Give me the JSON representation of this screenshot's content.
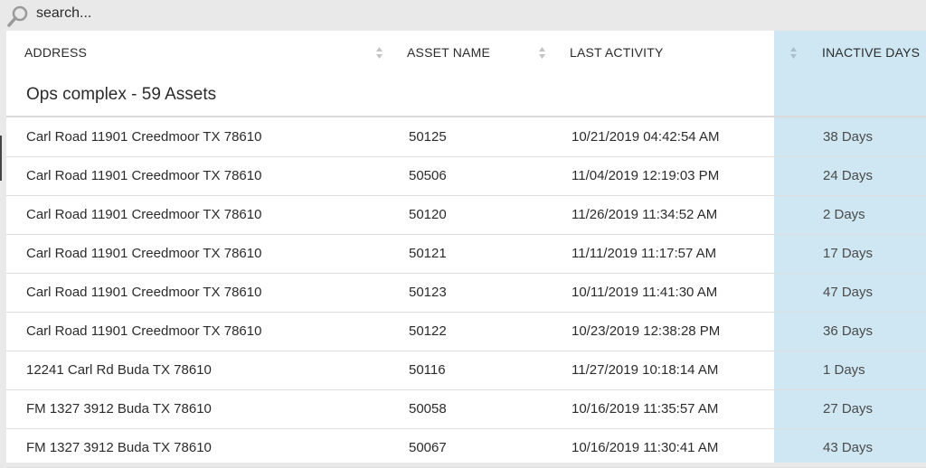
{
  "search": {
    "placeholder": "search..."
  },
  "columns": [
    {
      "label": "ADDRESS",
      "sortable": true
    },
    {
      "label": "ASSET NAME",
      "sortable": true
    },
    {
      "label": "LAST ACTIVITY",
      "sortable": false
    },
    {
      "label": "INACTIVE DAYS",
      "sortable": true,
      "highlighted": true
    }
  ],
  "group": {
    "title": "Ops complex - 59 Assets"
  },
  "rows": [
    {
      "address": "Carl Road 11901 Creedmoor TX 78610",
      "asset": "50125",
      "last_activity": "10/21/2019 04:42:54 AM",
      "inactive": "38 Days"
    },
    {
      "address": "Carl Road 11901 Creedmoor TX 78610",
      "asset": "50506",
      "last_activity": "11/04/2019 12:19:03 PM",
      "inactive": "24 Days"
    },
    {
      "address": "Carl Road 11901 Creedmoor TX 78610",
      "asset": "50120",
      "last_activity": "11/26/2019 11:34:52 AM",
      "inactive": "2 Days"
    },
    {
      "address": "Carl Road 11901 Creedmoor TX 78610",
      "asset": "50121",
      "last_activity": "11/11/2019 11:17:57 AM",
      "inactive": "17 Days"
    },
    {
      "address": "Carl Road 11901 Creedmoor TX 78610",
      "asset": "50123",
      "last_activity": "10/11/2019 11:41:30 AM",
      "inactive": "47 Days"
    },
    {
      "address": "Carl Road 11901 Creedmoor TX 78610",
      "asset": "50122",
      "last_activity": "10/23/2019 12:38:28 PM",
      "inactive": "36 Days"
    },
    {
      "address": "12241 Carl Rd Buda TX 78610",
      "asset": "50116",
      "last_activity": "11/27/2019 10:18:14 AM",
      "inactive": "1 Days"
    },
    {
      "address": "FM 1327 3912 Buda TX 78610",
      "asset": "50058",
      "last_activity": "10/16/2019 11:35:57 AM",
      "inactive": "27 Days"
    },
    {
      "address": "FM 1327 3912 Buda TX 78610",
      "asset": "50067",
      "last_activity": "10/16/2019 11:30:41 AM",
      "inactive": "43 Days"
    }
  ],
  "colors": {
    "highlight_column": "#cfe7f2",
    "background": "#e9e9e9",
    "text": "#2b2b2b"
  },
  "icons": {
    "search": "search-icon",
    "sort": "sort-arrows-icon"
  }
}
